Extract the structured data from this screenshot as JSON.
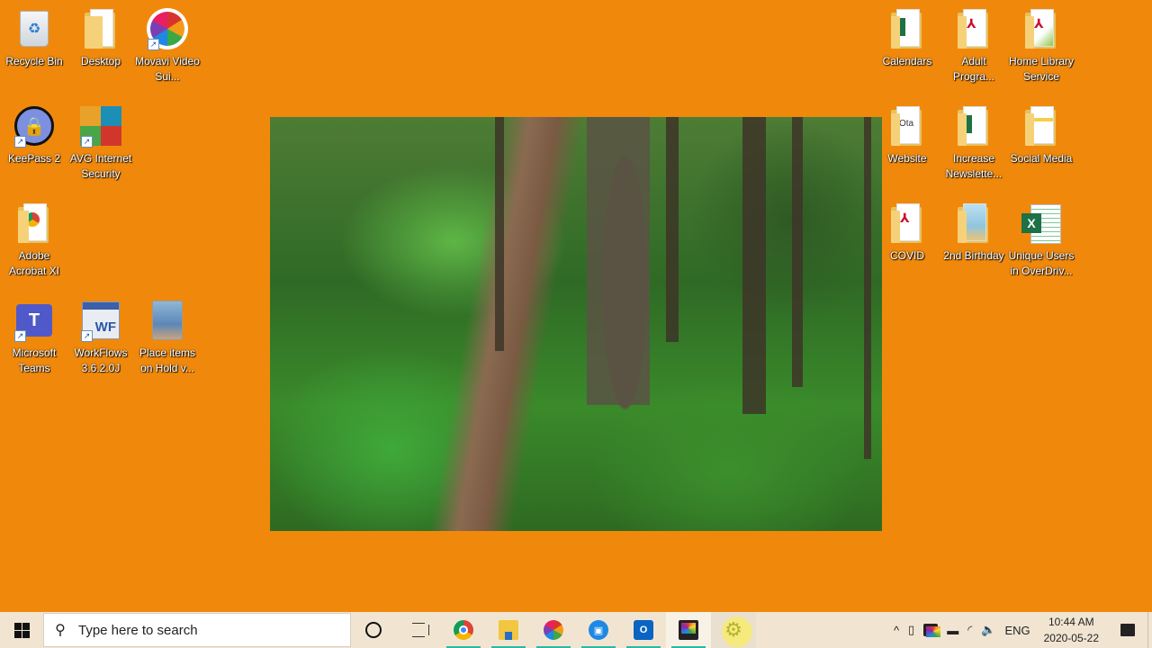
{
  "desktop": {
    "background_color": "#f0890b",
    "icons_left": [
      {
        "name": "recycle-bin",
        "label": "Recycle Bin",
        "icon": "recycle-bin-icon",
        "shortcut": false
      },
      {
        "name": "desktop-folder",
        "label": "Desktop",
        "icon": "folder-pdf-icon",
        "shortcut": false
      },
      {
        "name": "movavi",
        "label": "Movavi Video Sui...",
        "icon": "movavi-icon",
        "shortcut": true
      },
      {
        "name": "keepass",
        "label": "KeePass 2",
        "icon": "keepass-lock-icon",
        "shortcut": true
      },
      {
        "name": "avg",
        "label": "AVG Internet Security",
        "icon": "avg-icon",
        "shortcut": true
      },
      {
        "name": "adobe-acrobat",
        "label": "Adobe Acrobat XI",
        "icon": "folder-chrome-icon",
        "shortcut": false
      },
      {
        "name": "microsoft-teams",
        "label": "Microsoft Teams",
        "icon": "teams-icon",
        "shortcut": true
      },
      {
        "name": "workflows",
        "label": "WorkFlows 3.6.2.0J",
        "icon": "workflows-icon",
        "shortcut": true
      },
      {
        "name": "place-items-on-hold",
        "label": "Place items on Hold v...",
        "icon": "tablet-screenshot-icon",
        "shortcut": false
      }
    ],
    "icons_right": [
      {
        "name": "calendars",
        "label": "Calendars",
        "icon": "folder-excel-icon"
      },
      {
        "name": "adult-programs",
        "label": "Adult Progra...",
        "icon": "folder-pdf-icon"
      },
      {
        "name": "home-library-service",
        "label": "Home Library Service",
        "icon": "folder-pdf-icon"
      },
      {
        "name": "website",
        "label": "Website",
        "icon": "folder-doc-icon"
      },
      {
        "name": "increase-newsletter",
        "label": "Increase Newslette...",
        "icon": "folder-excel-icon"
      },
      {
        "name": "social-media",
        "label": "Social Media",
        "icon": "folder-doc-icon"
      },
      {
        "name": "covid",
        "label": "COVID",
        "icon": "folder-pdf-icon"
      },
      {
        "name": "2nd-birthday",
        "label": "2nd Birthday",
        "icon": "folder-image-icon"
      },
      {
        "name": "unique-users-overdrive",
        "label": "Unique Users in OverDriv...",
        "icon": "excel-file-icon"
      }
    ],
    "photo": {
      "description": "Forest trail with ferns and tall trees"
    }
  },
  "taskbar": {
    "start_icon": "windows-logo-icon",
    "search_placeholder": "Type here to search",
    "search_icon": "search-icon",
    "cortana_icon": "cortana-circle-icon",
    "task_view_icon": "task-view-icon",
    "apps": [
      {
        "name": "chrome",
        "icon": "chrome-icon",
        "running": true
      },
      {
        "name": "file-explorer",
        "icon": "file-explorer-icon",
        "running": true
      },
      {
        "name": "movavi",
        "icon": "movavi-icon",
        "running": true
      },
      {
        "name": "video-recorder",
        "icon": "video-recorder-icon",
        "running": true
      },
      {
        "name": "outlook",
        "icon": "outlook-icon",
        "running": true,
        "glyph": "O"
      },
      {
        "name": "screen-recorder",
        "icon": "screen-recorder-icon",
        "running": true,
        "active": true
      },
      {
        "name": "settings",
        "icon": "settings-gear-icon",
        "running": false,
        "hover": true
      }
    ],
    "tray": {
      "chevron": "^",
      "language": "ENG",
      "time": "10:44 AM",
      "date": "2020-05-22"
    },
    "accent_running": "#2ab8a8"
  }
}
